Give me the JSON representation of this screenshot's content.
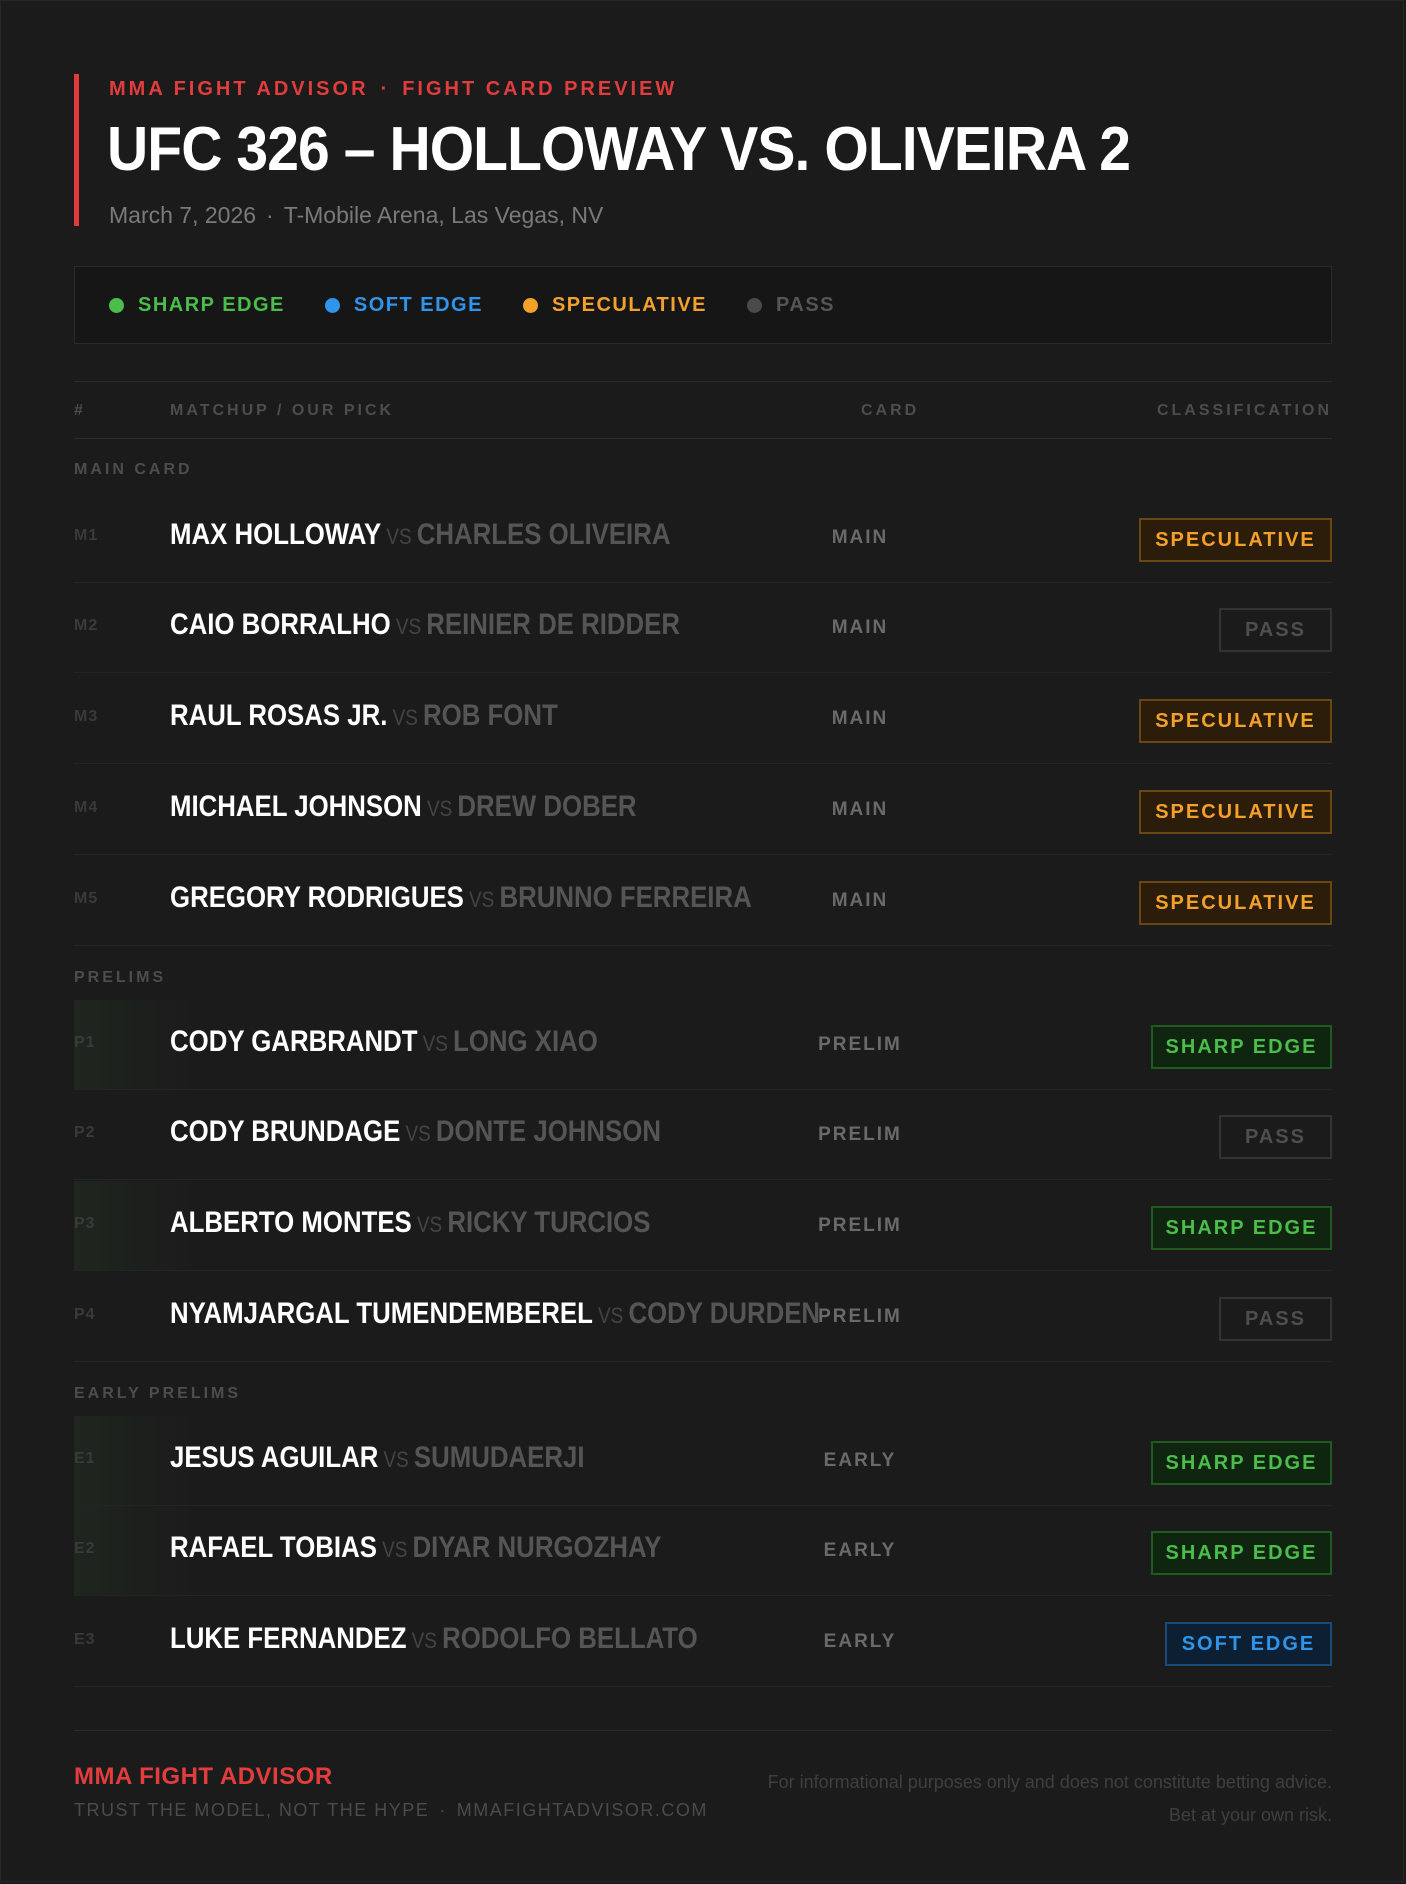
{
  "header": {
    "eyebrow_left": "MMA FIGHT ADVISOR",
    "eyebrow_sep": "·",
    "eyebrow_right": "FIGHT CARD PREVIEW",
    "title": "UFC 326 – HOLLOWAY VS. OLIVEIRA 2",
    "date": "March 7, 2026",
    "subtitle_sep": "·",
    "venue": "T-Mobile Arena, Las Vegas, NV"
  },
  "legend": [
    {
      "label": "SHARP EDGE",
      "color": "#4bbd4b"
    },
    {
      "label": "SOFT EDGE",
      "color": "#2f95ea"
    },
    {
      "label": "SPECULATIVE",
      "color": "#f3a12b"
    },
    {
      "label": "PASS",
      "color": "#555555"
    }
  ],
  "table_header": {
    "num": "#",
    "matchup": "MATCHUP / OUR PICK",
    "card": "CARD",
    "classification": "CLASSIFICATION"
  },
  "sections": {
    "main": "MAIN CARD",
    "prelims": "PRELIMS",
    "early": "EARLY PRELIMS"
  },
  "vs_label": "VS",
  "rows": [
    {
      "num": "M1",
      "pick": "MAX HOLLOWAY",
      "opponent": "CHARLES OLIVEIRA",
      "card": "MAIN",
      "classification": "SPECULATIVE"
    },
    {
      "num": "M2",
      "pick": "CAIO BORRALHO",
      "opponent": "REINIER DE RIDDER",
      "card": "MAIN",
      "classification": "PASS"
    },
    {
      "num": "M3",
      "pick": "RAUL ROSAS JR.",
      "opponent": "ROB FONT",
      "card": "MAIN",
      "classification": "SPECULATIVE"
    },
    {
      "num": "M4",
      "pick": "MICHAEL JOHNSON",
      "opponent": "DREW DOBER",
      "card": "MAIN",
      "classification": "SPECULATIVE"
    },
    {
      "num": "M5",
      "pick": "GREGORY RODRIGUES",
      "opponent": "BRUNNO FERREIRA",
      "card": "MAIN",
      "classification": "SPECULATIVE"
    },
    {
      "num": "P1",
      "pick": "CODY GARBRANDT",
      "opponent": "LONG XIAO",
      "card": "PRELIM",
      "classification": "SHARP EDGE"
    },
    {
      "num": "P2",
      "pick": "CODY BRUNDAGE",
      "opponent": "DONTE JOHNSON",
      "card": "PRELIM",
      "classification": "PASS"
    },
    {
      "num": "P3",
      "pick": "ALBERTO MONTES",
      "opponent": "RICKY TURCIOS",
      "card": "PRELIM",
      "classification": "SHARP EDGE"
    },
    {
      "num": "P4",
      "pick": "NYAMJARGAL TUMENDEMBEREL",
      "opponent": "CODY DURDEN",
      "card": "PRELIM",
      "classification": "PASS"
    },
    {
      "num": "E1",
      "pick": "JESUS AGUILAR",
      "opponent": "SUMUDAERJI",
      "card": "EARLY",
      "classification": "SHARP EDGE"
    },
    {
      "num": "E2",
      "pick": "RAFAEL TOBIAS",
      "opponent": "DIYAR NURGOZHAY",
      "card": "EARLY",
      "classification": "SHARP EDGE"
    },
    {
      "num": "E3",
      "pick": "LUKE FERNANDEZ",
      "opponent": "RODOLFO BELLATO",
      "card": "EARLY",
      "classification": "SOFT EDGE"
    }
  ],
  "footer": {
    "brand": "MMA FIGHT ADVISOR",
    "tagline": "TRUST THE MODEL, NOT THE HYPE",
    "tagline_sep": "·",
    "site": "MMAFIGHTADVISOR.COM",
    "disclaimer_line1": "For informational purposes only and does not constitute betting advice.",
    "disclaimer_line2": "Bet at your own risk."
  }
}
